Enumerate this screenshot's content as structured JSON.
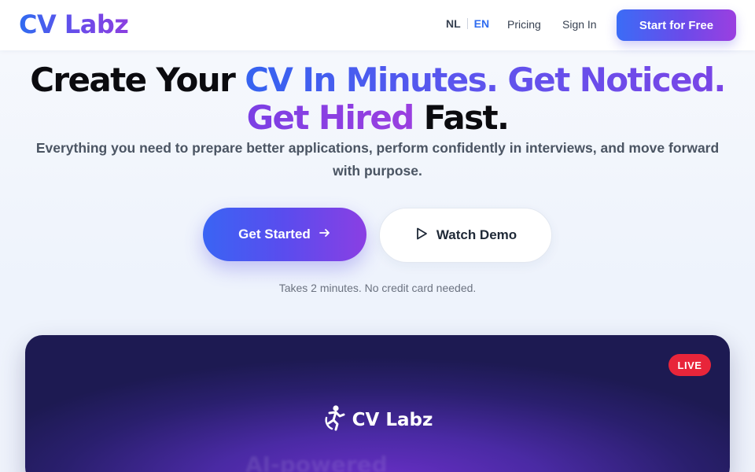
{
  "header": {
    "logo": "CV Labz",
    "lang_nl": "NL",
    "lang_en": "EN",
    "pricing": "Pricing",
    "sign_in": "Sign In",
    "cta": "Start for Free"
  },
  "hero": {
    "line1_plain": "Create Your ",
    "line1_grad": "CV In Minutes. Get Noticed.",
    "line2_grad": "Get Hired",
    "line2_plain": " Fast.",
    "subtitle": "Everything you need to prepare better applications, perform confidently in interviews, and move forward with purpose.",
    "primary_button": "Get Started",
    "secondary_button": "Watch Demo",
    "note": "Takes 2 minutes. No credit card needed."
  },
  "demo": {
    "badge": "LIVE",
    "logo": "CV Labz",
    "ghost_text": "AI-powered"
  },
  "icons": {
    "arrow": "arrow-right-icon",
    "play": "play-icon",
    "runner": "runner-logo-icon"
  },
  "colors": {
    "accent_blue": "#2f6cf0",
    "accent_purple": "#8b3fe0",
    "live_red": "#e8253a",
    "panel_dark": "#1d1a52"
  }
}
